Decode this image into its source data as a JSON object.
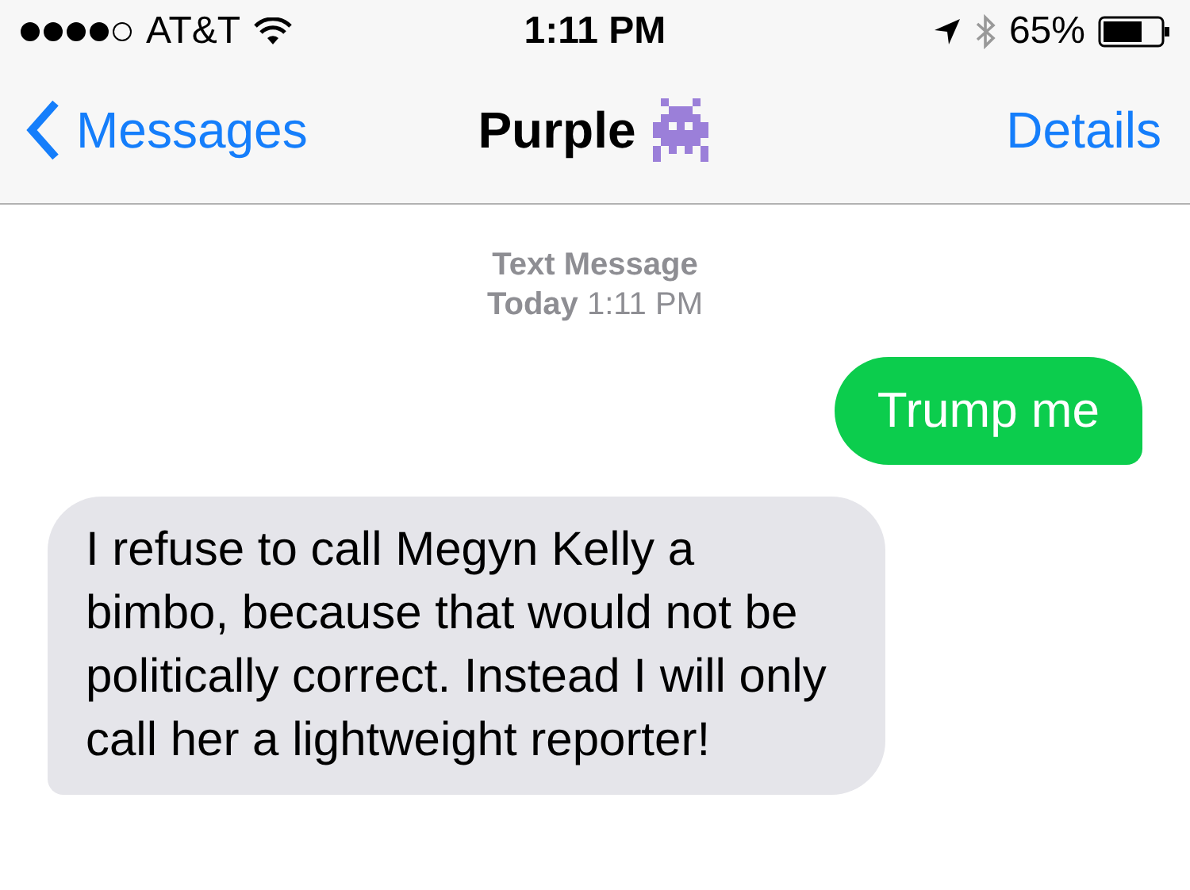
{
  "status_bar": {
    "carrier": "AT&T",
    "time": "1:11 PM",
    "battery": "65%"
  },
  "nav": {
    "back": "Messages",
    "title": "Purple",
    "action": "Details"
  },
  "thread_header": {
    "service": "Text Message",
    "timestamp": "**Today** 1:11 PM"
  },
  "messages": [
    {
      "kind": "sent",
      "text": "Trump me"
    },
    {
      "kind": "received",
      "text": "I refuse to call Megyn Kelly a bimbo, because that would not be politically correct. Instead I will only call her a lightweight reporter!"
    }
  ]
}
